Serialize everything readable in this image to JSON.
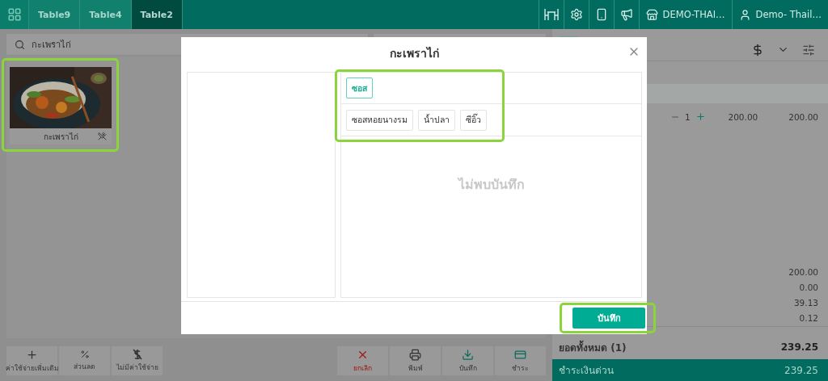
{
  "top_bar": {
    "tabs": [
      {
        "label": "Table9",
        "selected": false
      },
      {
        "label": "Table4",
        "selected": false
      },
      {
        "label": "Table2",
        "selected": true
      }
    ],
    "store": "DEMO-THAI…",
    "user": "Demo- Thail…"
  },
  "search": {
    "value": "กะเพราไก่"
  },
  "products": [
    {
      "name": "กะเพราไก่",
      "kind": "picture",
      "highlighted": true
    }
  ],
  "left_actions": [
    {
      "label": "ค่าใช้จ่ายเพิ่มเติม",
      "kind": "add"
    },
    {
      "label": "ส่วนลด",
      "kind": "discount"
    },
    {
      "label": "ไม่มีค่าใช้จ่าย",
      "kind": "free"
    }
  ],
  "order_actions": [
    {
      "label": "ยกเลิก",
      "kind": "cancel"
    },
    {
      "label": "พิมพ์",
      "kind": "print"
    },
    {
      "label": "บันทึก",
      "kind": "save"
    },
    {
      "label": "ชำระ",
      "kind": "pay"
    }
  ],
  "order": {
    "items": [
      {
        "quantity": "1",
        "price": "200.00",
        "total": "200.00"
      }
    ],
    "summary": [
      "200.00",
      "0.00",
      "39.13",
      "0.12"
    ],
    "total_label": "ยอดทั้งหมด (1)",
    "total": "239.25",
    "quick_pay": {
      "label": "ชำระเงินด่วน",
      "amount": "239.25"
    }
  },
  "modal": {
    "title": "กะเพราไก่",
    "categories": [
      {
        "label": "ซอส",
        "selected": true
      }
    ],
    "options": [
      "ซอสหอยนางรม",
      "น้ำปลา",
      "ซีอิ๊ว"
    ],
    "options_highlighted": true,
    "empty_text": "ไม่พบบันทึก",
    "save": "บันทึก",
    "save_highlighted": true
  }
}
